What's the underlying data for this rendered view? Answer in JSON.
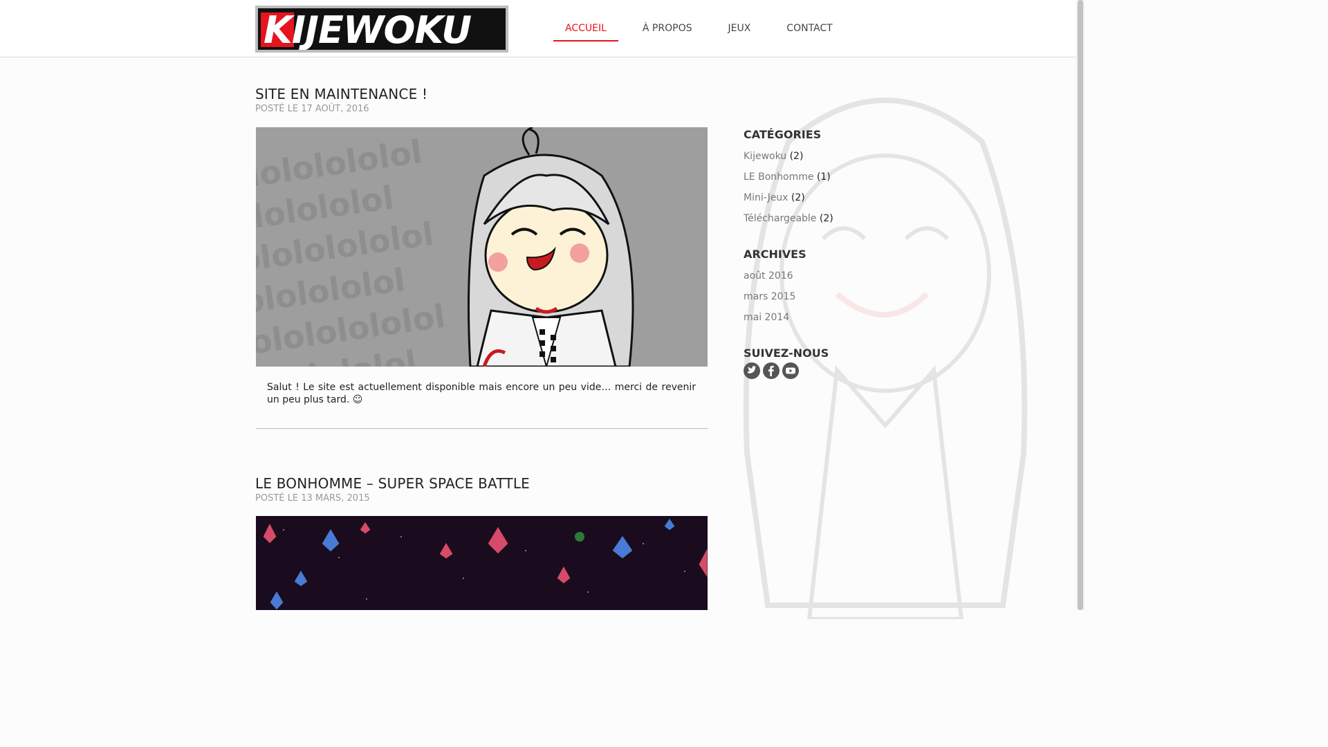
{
  "header": {
    "logo_text": "KIJEWOKU",
    "nav": [
      {
        "label": "ACCUEIL",
        "active": true
      },
      {
        "label": "À PROPOS",
        "active": false
      },
      {
        "label": "JEUX",
        "active": false
      },
      {
        "label": "CONTACT",
        "active": false
      }
    ]
  },
  "posts": [
    {
      "title": "SITE EN MAINTENANCE !",
      "date": "POSTÉ LE 17 AOÛT, 2016",
      "image_pattern_text": "lolololololol",
      "text": "Salut ! Le site est actuellement disponible mais encore un peu vide… merci de revenir un peu plus tard. ☺"
    },
    {
      "title": "LE BONHOMME – SUPER SPACE BATTLE",
      "date": "POSTÉ LE 13 MARS, 2015"
    }
  ],
  "sidebar": {
    "categories_heading": "CATÉGORIES",
    "categories": [
      {
        "name": "Kijewoku",
        "count": "(2)"
      },
      {
        "name": "LE Bonhomme",
        "count": "(1)"
      },
      {
        "name": "Mini-Jeux",
        "count": "(2)"
      },
      {
        "name": "Téléchargeable",
        "count": "(2)"
      }
    ],
    "archives_heading": "ARCHIVES",
    "archives": [
      "août 2016",
      "mars 2015",
      "mai 2014"
    ],
    "follow_heading": "SUIVEZ-NOUS",
    "social": [
      "twitter-icon",
      "facebook-icon",
      "youtube-icon"
    ]
  },
  "colors": {
    "accent": "#e5141d",
    "social_icon": "#555555"
  }
}
